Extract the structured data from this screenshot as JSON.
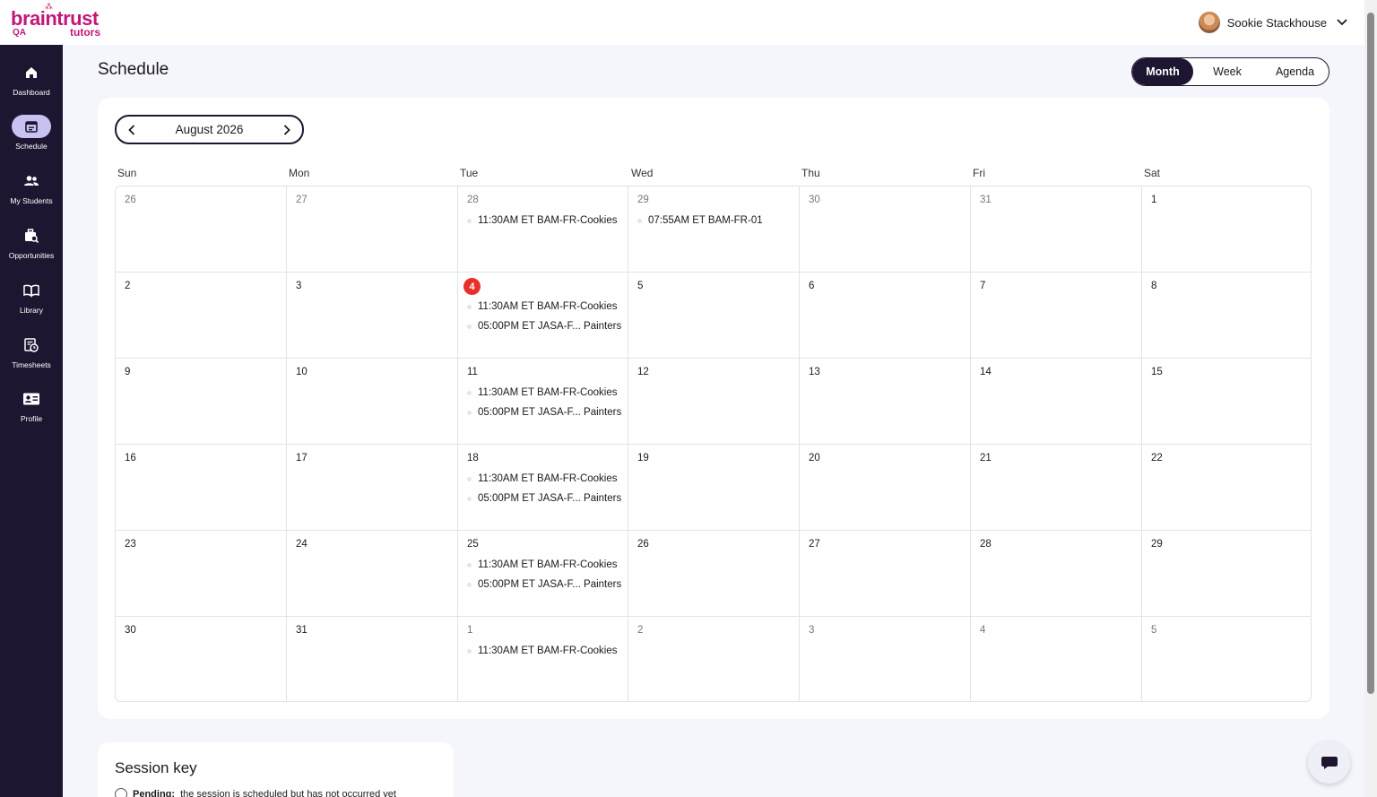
{
  "brand": {
    "name": "braintrust",
    "sub": "tutors",
    "env": "QA"
  },
  "user": {
    "name": "Sookie Stackhouse"
  },
  "sidebar": {
    "items": [
      {
        "label": "Dashboard",
        "icon": "home-icon"
      },
      {
        "label": "Schedule",
        "icon": "calendar-icon",
        "active": true
      },
      {
        "label": "My Students",
        "icon": "users-icon"
      },
      {
        "label": "Opportunities",
        "icon": "briefcase-search-icon"
      },
      {
        "label": "Library",
        "icon": "book-icon"
      },
      {
        "label": "Timesheets",
        "icon": "timesheet-icon"
      },
      {
        "label": "Profile",
        "icon": "id-card-icon"
      }
    ]
  },
  "page": {
    "title": "Schedule"
  },
  "views": {
    "month": "Month",
    "week": "Week",
    "agenda": "Agenda",
    "selected": "Month"
  },
  "calendar": {
    "month_label": "August 2026",
    "weekdays": [
      "Sun",
      "Mon",
      "Tue",
      "Wed",
      "Thu",
      "Fri",
      "Sat"
    ],
    "weeks": [
      [
        {
          "day": "26",
          "muted": true,
          "events": []
        },
        {
          "day": "27",
          "muted": true,
          "events": []
        },
        {
          "day": "28",
          "muted": true,
          "events": [
            "11:30AM ET BAM-FR-Cookies"
          ]
        },
        {
          "day": "29",
          "muted": true,
          "events": [
            "07:55AM ET BAM-FR-01"
          ]
        },
        {
          "day": "30",
          "muted": true,
          "events": []
        },
        {
          "day": "31",
          "muted": true,
          "events": []
        },
        {
          "day": "1",
          "events": []
        }
      ],
      [
        {
          "day": "2",
          "events": []
        },
        {
          "day": "3",
          "events": []
        },
        {
          "day": "4",
          "today": true,
          "events": [
            "11:30AM ET BAM-FR-Cookies",
            "05:00PM ET JASA-F... Painters"
          ]
        },
        {
          "day": "5",
          "events": []
        },
        {
          "day": "6",
          "events": []
        },
        {
          "day": "7",
          "events": []
        },
        {
          "day": "8",
          "events": []
        }
      ],
      [
        {
          "day": "9",
          "events": []
        },
        {
          "day": "10",
          "events": []
        },
        {
          "day": "11",
          "events": [
            "11:30AM ET BAM-FR-Cookies",
            "05:00PM ET JASA-F... Painters"
          ]
        },
        {
          "day": "12",
          "events": []
        },
        {
          "day": "13",
          "events": []
        },
        {
          "day": "14",
          "events": []
        },
        {
          "day": "15",
          "events": []
        }
      ],
      [
        {
          "day": "16",
          "events": []
        },
        {
          "day": "17",
          "events": []
        },
        {
          "day": "18",
          "events": [
            "11:30AM ET BAM-FR-Cookies",
            "05:00PM ET JASA-F... Painters"
          ]
        },
        {
          "day": "19",
          "events": []
        },
        {
          "day": "20",
          "events": []
        },
        {
          "day": "21",
          "events": []
        },
        {
          "day": "22",
          "events": []
        }
      ],
      [
        {
          "day": "23",
          "events": []
        },
        {
          "day": "24",
          "events": []
        },
        {
          "day": "25",
          "events": [
            "11:30AM ET BAM-FR-Cookies",
            "05:00PM ET JASA-F... Painters"
          ]
        },
        {
          "day": "26",
          "events": []
        },
        {
          "day": "27",
          "events": []
        },
        {
          "day": "28",
          "events": []
        },
        {
          "day": "29",
          "events": []
        }
      ],
      [
        {
          "day": "30",
          "events": []
        },
        {
          "day": "31",
          "events": []
        },
        {
          "day": "1",
          "muted": true,
          "events": [
            "11:30AM ET BAM-FR-Cookies"
          ]
        },
        {
          "day": "2",
          "muted": true,
          "events": []
        },
        {
          "day": "3",
          "muted": true,
          "events": []
        },
        {
          "day": "4",
          "muted": true,
          "events": []
        },
        {
          "day": "5",
          "muted": true,
          "events": []
        }
      ]
    ]
  },
  "session_key": {
    "title": "Session key",
    "rows": [
      {
        "label": "Pending:",
        "text": "the session is scheduled but has not occurred yet"
      }
    ]
  },
  "colors": {
    "sidebar_bg": "#1e1530",
    "brand": "#c2177a",
    "today": "#e8302a",
    "active_nav": "#c8c2f0"
  }
}
